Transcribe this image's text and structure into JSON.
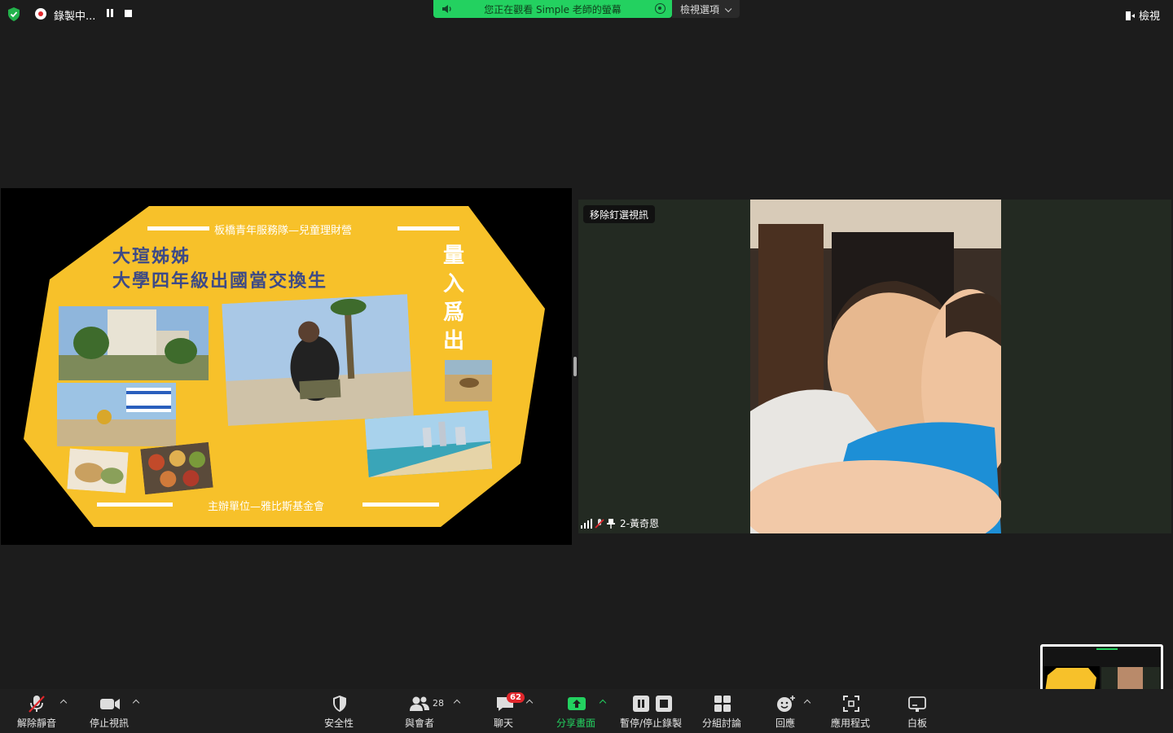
{
  "recording": {
    "label": "錄製中..."
  },
  "share_banner": {
    "text": "您正在觀看 Simple 老師的螢幕",
    "view_options": "檢視選項"
  },
  "view_button": "檢視",
  "slide": {
    "top_text": "板橋青年服務隊—兒童理財營",
    "title_line1": "大瑄姊姊",
    "title_line2": "大學四年級出國當交換生",
    "vertical_title": [
      "量",
      "入",
      "爲",
      "出"
    ],
    "bottom_text": "主辦單位—雅比斯基金會"
  },
  "video": {
    "unpin_label": "移除釘選視訊",
    "participant_name": "2-黃奇恩"
  },
  "toolbar": {
    "unmute": "解除靜音",
    "stop_video": "停止視訊",
    "security": "安全性",
    "participants": "與會者",
    "participants_count": "28",
    "chat": "聊天",
    "chat_badge": "62",
    "share_screen": "分享畫面",
    "pause_stop_recording": "暫停/停止錄製",
    "breakout": "分組討論",
    "reactions": "回應",
    "apps": "應用程式",
    "whiteboard": "白板"
  },
  "colors": {
    "accent_green": "#23d160",
    "slide_yellow": "#f7c12a",
    "badge_red": "#e0262b"
  }
}
